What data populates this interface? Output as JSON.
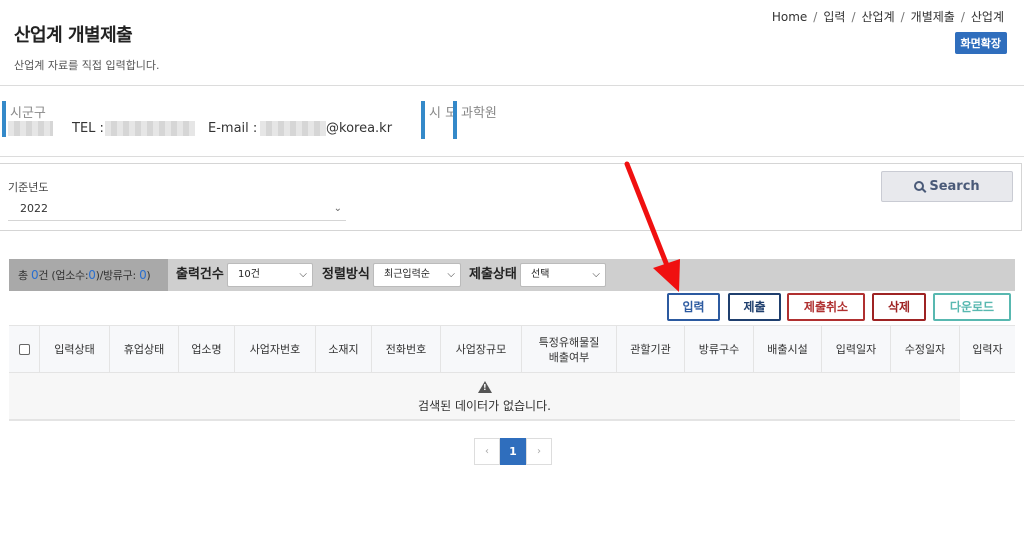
{
  "header": {
    "title": "산업계 개별제출",
    "description": "산업계 자료를 직접 입력합니다.",
    "breadcrumb": [
      "Home",
      "입력",
      "산업계",
      "개별제출",
      "산업계"
    ],
    "expand_button": "화면확장"
  },
  "info": {
    "region_label": "시군구",
    "tel_label": "TEL :",
    "email_label": "E-mail :",
    "email_domain": "@korea.kr",
    "city_label": "시 도",
    "institute": "과학원"
  },
  "search": {
    "year_label": "기준년도",
    "year_value": "2022",
    "button_label": "Search"
  },
  "filter": {
    "count_prefix": "총",
    "total": "0",
    "count_mid": "건 (업소수:",
    "business_count": "0",
    "count_mid2": ")/방류구:",
    "outlet_count": "0",
    "count_suffix": ")",
    "page_size_label": "출력건수",
    "page_size_value": "10건",
    "sort_label": "정렬방식",
    "sort_value": "최근입력순",
    "status_label": "제출상태",
    "status_value": "선택"
  },
  "actions": {
    "input": "입력",
    "submit": "제출",
    "cancel_submit": "제출취소",
    "delete": "삭제",
    "download": "다운로드"
  },
  "table": {
    "columns": [
      "입력상태",
      "휴업상태",
      "업소명",
      "사업자번호",
      "소재지",
      "전화번호",
      "사업장규모",
      "특정유해물질 배출여부",
      "관할기관",
      "방류구수",
      "배출시설",
      "입력일자",
      "수정일자",
      "입력자"
    ],
    "empty_message": "검색된 데이터가 없습니다."
  },
  "pagination": {
    "prev": "‹",
    "current": "1",
    "next": "›"
  },
  "colors": {
    "accent": "#2f6ebd",
    "input_btn": "#2c5aa0",
    "submit_btn": "#1f3f6e",
    "cancel_btn": "#b03030",
    "delete_btn": "#9e2323",
    "download_btn": "#58b8b0",
    "arrow": "#f01010"
  }
}
